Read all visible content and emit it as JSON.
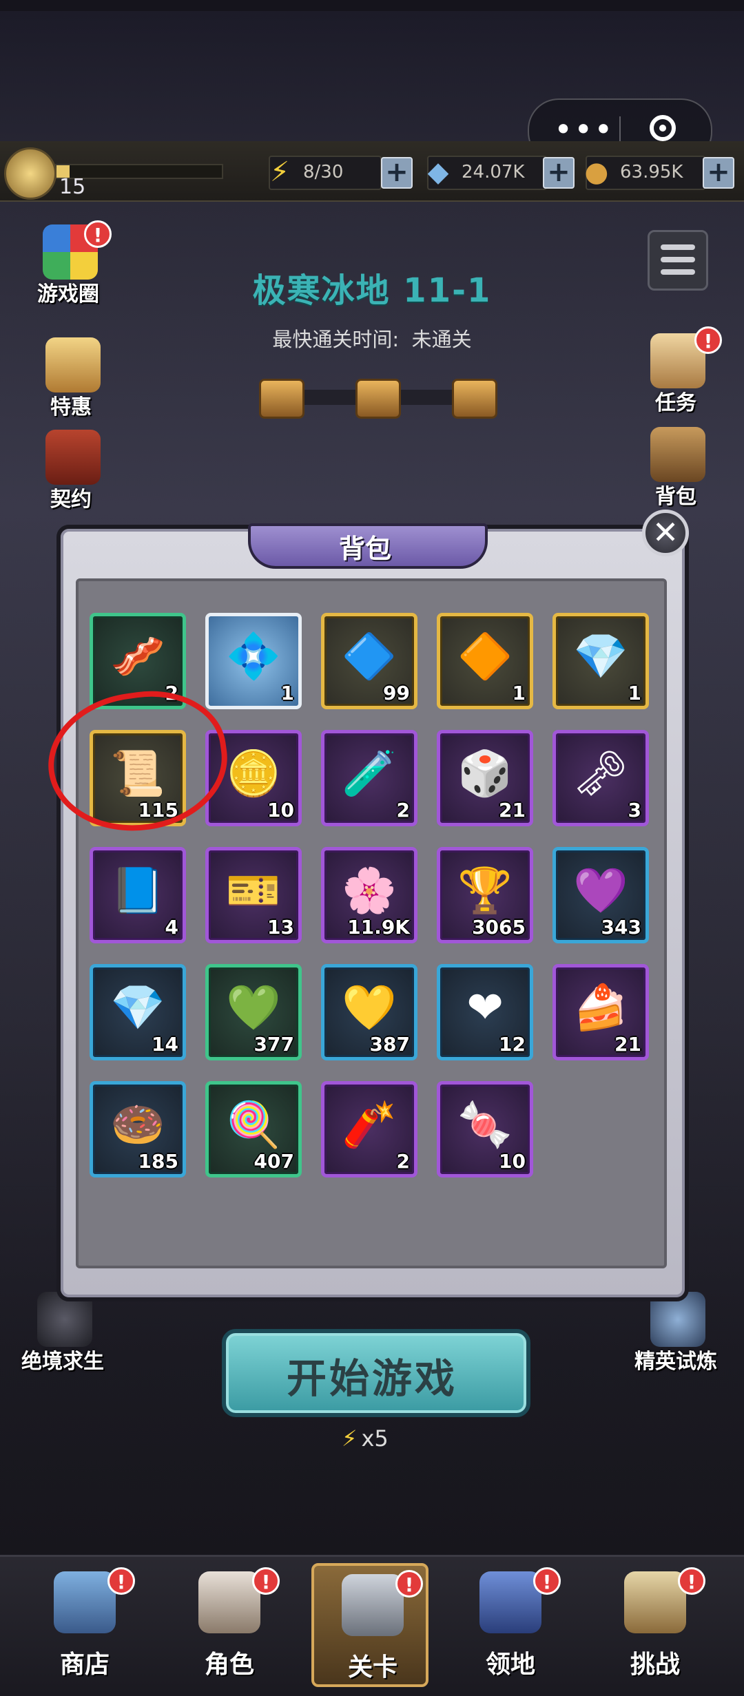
{
  "capsule": {
    "more_icon": "more-dots-icon",
    "close_icon": "target-icon"
  },
  "topbar": {
    "level": "15",
    "energy": "8/30",
    "diamonds": "24.07K",
    "coins": "63.95K",
    "energy_progress": 0.27,
    "xp_progress": 0.08
  },
  "left_menu": [
    {
      "label": "游戏圈",
      "icon": "game-circle-icon",
      "badge": "!"
    },
    {
      "label": "特惠",
      "icon": "gift-icon"
    },
    {
      "label": "契约",
      "icon": "contract-icon"
    }
  ],
  "right_menu": [
    {
      "label": "任务",
      "icon": "quest-scroll-icon",
      "badge": "!"
    },
    {
      "label": "背包",
      "icon": "backpack-icon"
    }
  ],
  "stage": {
    "title": "极寒冰地 11-1",
    "fastest_label": "最快通关时间:",
    "fastest_value": "未通关"
  },
  "modal": {
    "title": "背包",
    "close_icon": "close-icon",
    "items": [
      {
        "name": "bacon",
        "icon": "🥓",
        "rarity": "green",
        "count": "2"
      },
      {
        "name": "blue-stone",
        "icon": "💠",
        "rarity": "white",
        "count": "1"
      },
      {
        "name": "crystal-shard-gold",
        "icon": "🔷",
        "rarity": "gold",
        "count": "99"
      },
      {
        "name": "golden-crystal",
        "icon": "🔶",
        "rarity": "gold",
        "count": "1"
      },
      {
        "name": "cyan-crystal",
        "icon": "💎",
        "rarity": "gold",
        "count": "1"
      },
      {
        "name": "scroll",
        "icon": "📜",
        "rarity": "gold",
        "count": "115"
      },
      {
        "name": "gold-coin",
        "icon": "🪙",
        "rarity": "purple",
        "count": "10"
      },
      {
        "name": "potion",
        "icon": "🧪",
        "rarity": "purple",
        "count": "2"
      },
      {
        "name": "dice",
        "icon": "🎲",
        "rarity": "purple",
        "count": "21"
      },
      {
        "name": "gold-key",
        "icon": "🗝",
        "rarity": "purple",
        "count": "3"
      },
      {
        "name": "magic-book",
        "icon": "📘",
        "rarity": "purple",
        "count": "4"
      },
      {
        "name": "ticket",
        "icon": "🎫",
        "rarity": "purple",
        "count": "13"
      },
      {
        "name": "violet-flower",
        "icon": "🌸",
        "rarity": "purple",
        "count": "11.9K"
      },
      {
        "name": "trophy",
        "icon": "🏆",
        "rarity": "purple",
        "count": "3065"
      },
      {
        "name": "purple-gem",
        "icon": "💜",
        "rarity": "blue",
        "count": "343"
      },
      {
        "name": "blue-gem",
        "icon": "💎",
        "rarity": "blue",
        "count": "14"
      },
      {
        "name": "green-gem",
        "icon": "💚",
        "rarity": "green",
        "count": "377"
      },
      {
        "name": "yellow-gem",
        "icon": "💛",
        "rarity": "blue",
        "count": "387"
      },
      {
        "name": "red-gem",
        "icon": "❤",
        "rarity": "blue",
        "count": "12"
      },
      {
        "name": "cake",
        "icon": "🍰",
        "rarity": "purple",
        "count": "21"
      },
      {
        "name": "donut",
        "icon": "🍩",
        "rarity": "blue",
        "count": "185"
      },
      {
        "name": "lollipop",
        "icon": "🍭",
        "rarity": "green",
        "count": "407"
      },
      {
        "name": "tnt",
        "icon": "🧨",
        "rarity": "purple",
        "count": "2"
      },
      {
        "name": "candy",
        "icon": "🍬",
        "rarity": "purple",
        "count": "10"
      }
    ]
  },
  "side_bottom": {
    "left": {
      "label": "绝境求生",
      "icon": "skull-helmet-icon"
    },
    "right": {
      "label": "精英试炼",
      "icon": "elite-castle-icon"
    }
  },
  "start": {
    "label": "开始游戏",
    "cost": "x5"
  },
  "nav": [
    {
      "label": "商店",
      "icon": "shop-icon",
      "badge": "!"
    },
    {
      "label": "角色",
      "icon": "character-icon",
      "badge": "!"
    },
    {
      "label": "关卡",
      "icon": "crossed-swords-icon",
      "badge": "!",
      "active": true
    },
    {
      "label": "领地",
      "icon": "castle-icon",
      "badge": "!"
    },
    {
      "label": "挑战",
      "icon": "challenge-map-icon",
      "badge": "!"
    }
  ],
  "colors": {
    "accent_teal": "#3bb3b5",
    "badge_red": "#e23a3a",
    "annotation_red": "#e11c1c"
  }
}
